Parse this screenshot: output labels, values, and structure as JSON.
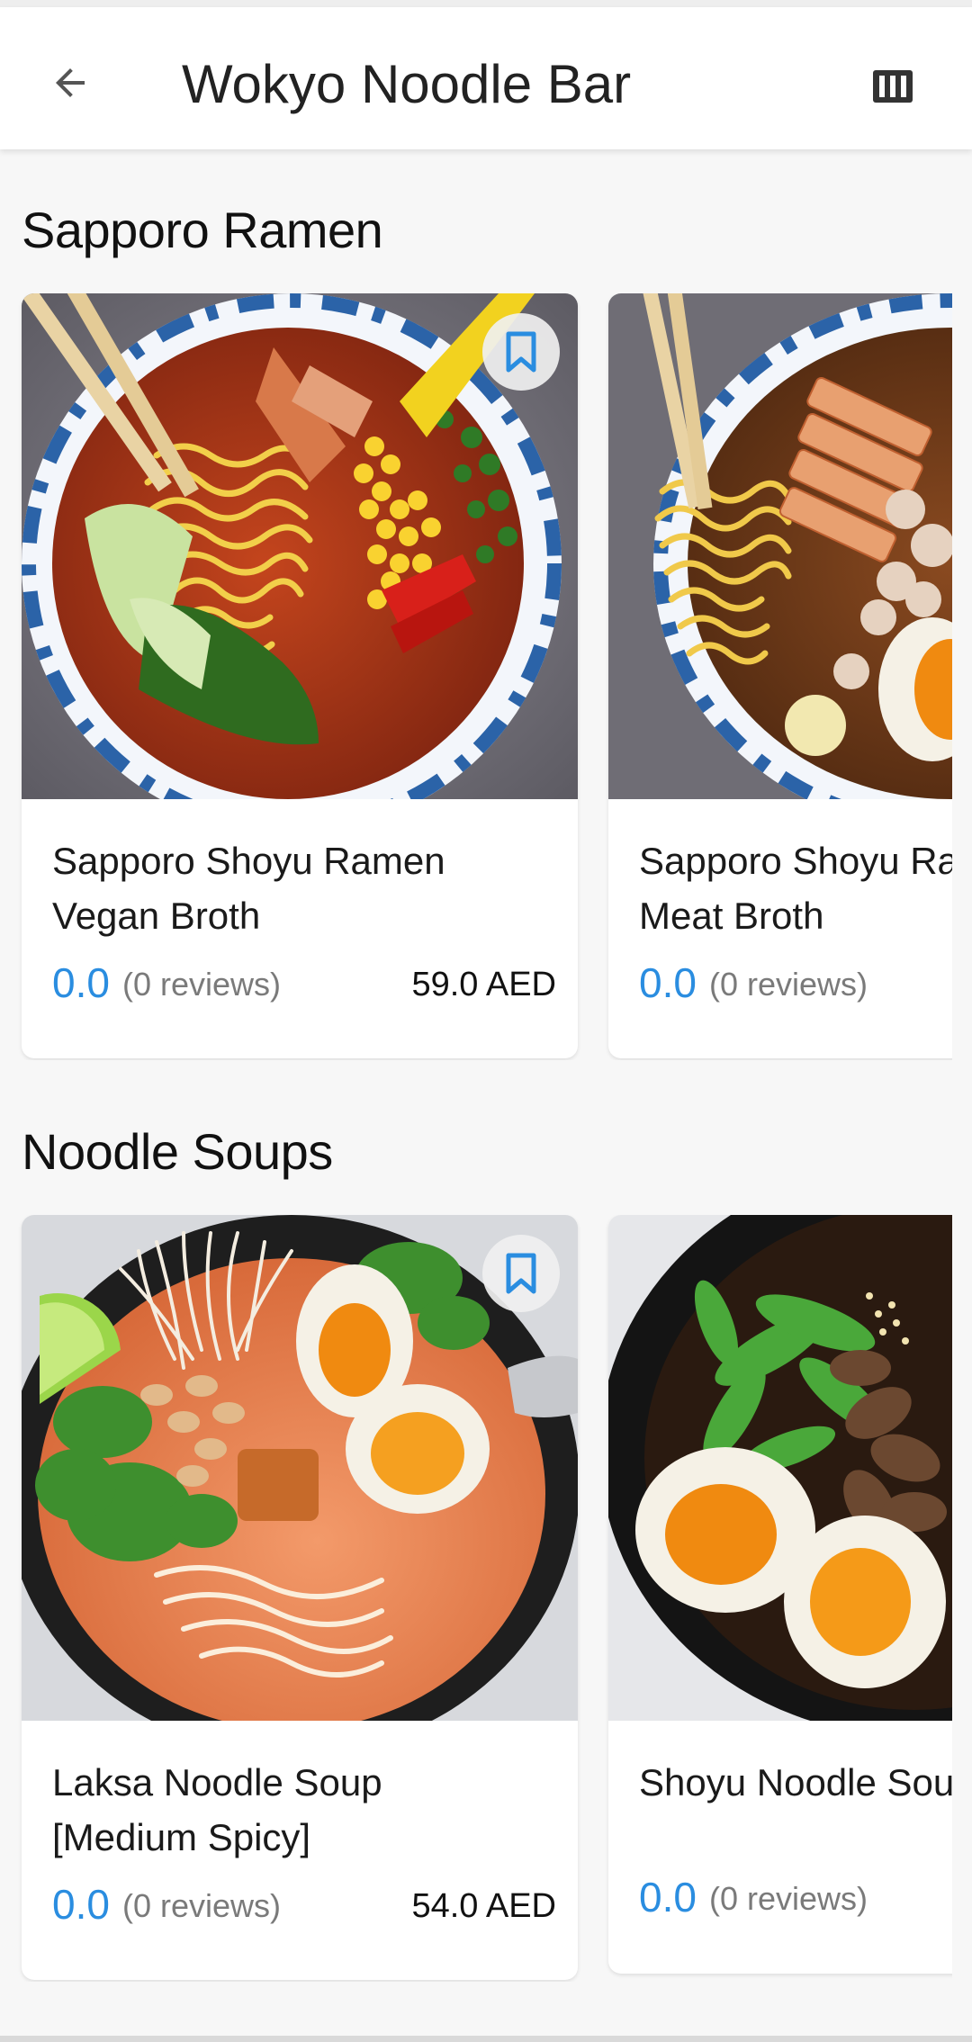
{
  "app_bar": {
    "title": "Wokyo Noodle Bar",
    "back_icon": "arrow-left-icon",
    "menu_icon": "menu-book-icon"
  },
  "sections": [
    {
      "title": "Sapporo Ramen",
      "cards": [
        {
          "name_line1": "Sapporo Shoyu Ramen",
          "name_line2": "Vegan Broth",
          "rating": "0.0",
          "reviews": "(0 reviews)",
          "price": "59.0 AED",
          "bookmarked": false,
          "image": "ramen-vegan-bowl"
        },
        {
          "name_line1": "Sapporo Shoyu Ramen",
          "name_line2": "Meat Broth",
          "rating": "0.0",
          "reviews": "(0 reviews)",
          "price": "",
          "bookmarked": false,
          "image": "ramen-meat-bowl"
        }
      ]
    },
    {
      "title": "Noodle Soups",
      "cards": [
        {
          "name_line1": "Laksa Noodle Soup",
          "name_line2": "[Medium Spicy]",
          "rating": "0.0",
          "reviews": "(0 reviews)",
          "price": "54.0 AED",
          "bookmarked": false,
          "image": "laksa-bowl"
        },
        {
          "name_line1": "Shoyu Noodle Soup",
          "name_line2": "",
          "rating": "0.0",
          "reviews": "(0 reviews)",
          "price": "",
          "bookmarked": false,
          "image": "shoyu-soup-bowl"
        }
      ]
    }
  ],
  "colors": {
    "accent": "#2a8de0",
    "background": "#f7f7f7",
    "card": "#ffffff",
    "bookmark_bg": "#f0f0f0"
  }
}
